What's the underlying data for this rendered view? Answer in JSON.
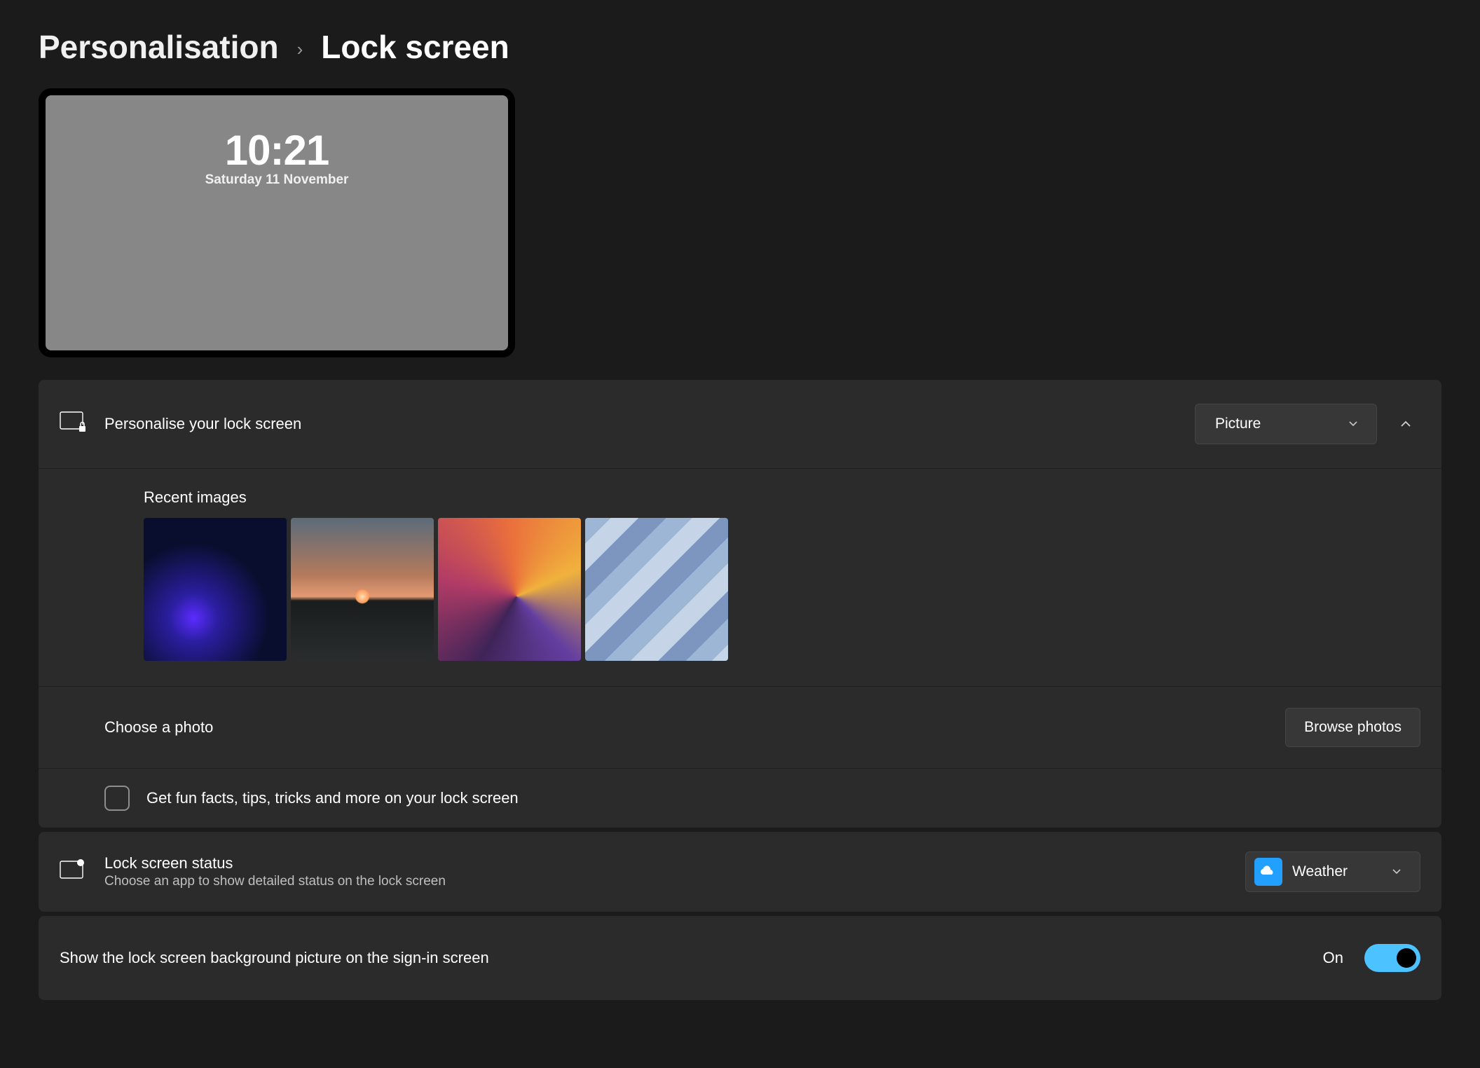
{
  "breadcrumb": {
    "parent": "Personalisation",
    "current": "Lock screen"
  },
  "preview": {
    "time": "10:21",
    "date": "Saturday 11 November"
  },
  "personalise": {
    "title": "Personalise your lock screen",
    "dropdown_value": "Picture"
  },
  "recent": {
    "heading": "Recent images"
  },
  "choose_photo": {
    "label": "Choose a photo",
    "button": "Browse photos"
  },
  "fun_facts": {
    "label": "Get fun facts, tips, tricks and more on your lock screen",
    "checked": false
  },
  "status_row": {
    "title": "Lock screen status",
    "subtitle": "Choose an app to show detailed status on the lock screen",
    "dropdown_value": "Weather"
  },
  "signin_row": {
    "label": "Show the lock screen background picture on the sign-in screen",
    "state_label": "On",
    "state": true
  }
}
